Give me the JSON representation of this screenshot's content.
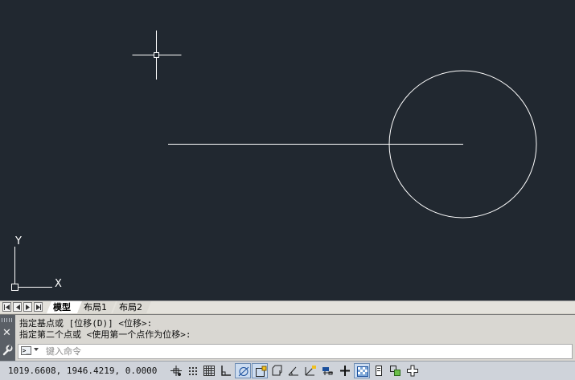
{
  "layout_tabs": [
    {
      "label": "模型",
      "active": true
    },
    {
      "label": "布局1",
      "active": false
    },
    {
      "label": "布局2",
      "active": false
    }
  ],
  "ucs": {
    "y_label": "Y",
    "x_label": "X"
  },
  "command_history": [
    "指定基点或 [位移(D)] <位移>:",
    "指定第二个点或 <使用第一个点作为位移>:"
  ],
  "command_line": {
    "placeholder": "键入命令",
    "value": ""
  },
  "status_bar": {
    "coordinates": "1019.6608, 1946.4219, 0.0000"
  },
  "status_buttons": [
    {
      "name": "infer-constraints-icon",
      "on": false
    },
    {
      "name": "snap-mode-icon",
      "on": false
    },
    {
      "name": "grid-display-icon",
      "on": false
    },
    {
      "name": "ortho-mode-icon",
      "on": false
    },
    {
      "name": "polar-tracking-icon",
      "on": true
    },
    {
      "name": "object-snap-icon",
      "on": true
    },
    {
      "name": "3d-object-snap-icon",
      "on": false
    },
    {
      "name": "object-snap-tracking-icon",
      "on": false
    },
    {
      "name": "dynamic-ucs-icon",
      "on": false
    },
    {
      "name": "dynamic-input-icon",
      "on": false
    },
    {
      "name": "lineweight-icon",
      "on": false
    },
    {
      "name": "transparency-icon",
      "on": true
    },
    {
      "name": "quick-properties-icon",
      "on": false
    },
    {
      "name": "selection-cycling-icon",
      "on": false
    },
    {
      "name": "annotation-monitor-icon",
      "on": false
    }
  ],
  "colors": {
    "canvas": "#212830",
    "geometry": "#ffffff"
  }
}
